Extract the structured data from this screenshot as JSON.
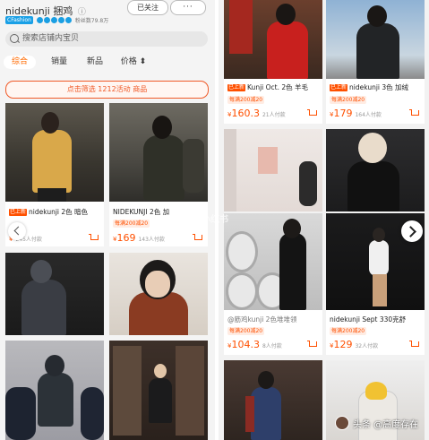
{
  "header": {
    "shop_name": "nidekunji 捆鸡",
    "info_icon": "ⓘ",
    "tmall_badge": "CFashion",
    "fans": "粉丝数79.8万",
    "follow_label": "已关注",
    "more_label": "···"
  },
  "search": {
    "placeholder": "搜索店铺内宝贝",
    "icon": "search-icon"
  },
  "tabs": [
    {
      "label": "综合",
      "active": true
    },
    {
      "label": "销量"
    },
    {
      "label": "新品"
    },
    {
      "label": "价格 ⬍"
    }
  ],
  "banner": {
    "label": "点击筛选 1212活动 商品"
  },
  "left_products": [
    {
      "brand_tag": "已上新",
      "title": "nidekunji 2色 暗色",
      "price_cur": "¥",
      "price": "",
      "sold": "245人付款"
    },
    {
      "brand_tag": "",
      "title": "NIDEKUNJI 2色 加",
      "promo": "每满200减20",
      "price_cur": "¥",
      "price": "169",
      "sold": "143人付款"
    }
  ],
  "right_products": [
    {
      "brand_tag": "已上新",
      "title": "Kunji Oct. 2色 羊毛",
      "promo": "每满200减20",
      "price_cur": "¥",
      "price": "160.3",
      "sold": "21人付款"
    },
    {
      "brand_tag": "已上新",
      "title": "nidekunji 3色 加绒",
      "promo": "每满200减20",
      "price_cur": "¥",
      "price": "179",
      "sold": "164人付款"
    },
    {
      "brand_tag": "",
      "title": "@筋鸡kunji 2色堆堆领",
      "promo": "每满200减20",
      "price_cur": "¥",
      "price": "104.3",
      "sold": "8人付款"
    },
    {
      "brand_tag": "",
      "title": "nidekunji Sept 330克舒",
      "promo": "每满200减20",
      "price_cur": "¥",
      "price": "129",
      "sold": "32人付款"
    }
  ],
  "watermark": {
    "text": "头条 @高度存在",
    "overlay": "小红书"
  },
  "colors": {
    "accent": "#ff5000",
    "tab_active": "#ff6a00",
    "badge_blue": "#1aa0e6"
  }
}
